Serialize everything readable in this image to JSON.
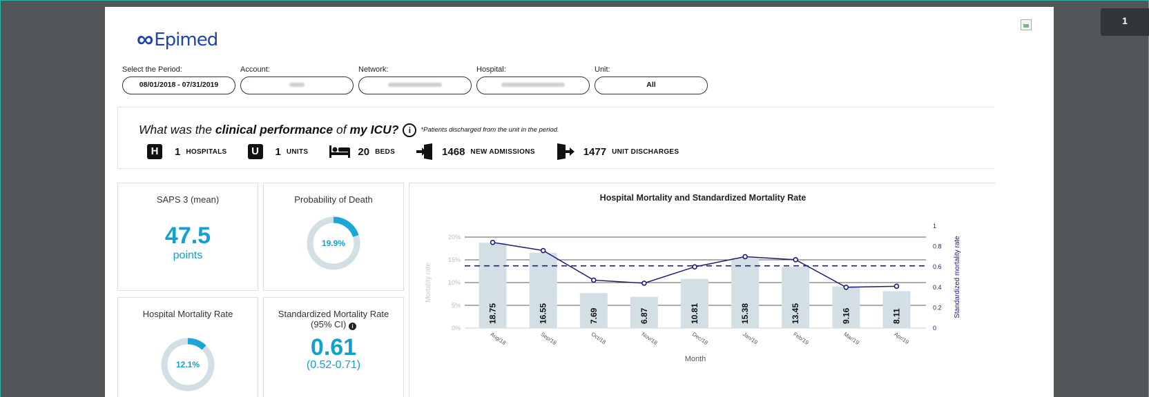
{
  "page_number": "1",
  "brand": {
    "logo_text": "Epimed"
  },
  "filters": {
    "period": {
      "label": "Select the Period:",
      "value": "08/01/2018 - 07/31/2019"
    },
    "account": {
      "label": "Account:"
    },
    "network": {
      "label": "Network:"
    },
    "hospital": {
      "label": "Hospital:"
    },
    "unit": {
      "label": "Unit:",
      "value": "All"
    }
  },
  "summary": {
    "question_start": "What was the ",
    "question_bold": "clinical performance",
    "question_mid": " of ",
    "question_end": "my ICU?",
    "footnote": "*Patients discharged from the unit in the period.",
    "stats": [
      {
        "icon": "H",
        "value": "1",
        "label": "HOSPITALS"
      },
      {
        "icon": "U",
        "value": "1",
        "label": "UNITS"
      },
      {
        "icon": "bed",
        "value": "20",
        "label": "BEDS"
      },
      {
        "icon": "enter",
        "value": "1468",
        "label": "NEW ADMISSIONS"
      },
      {
        "icon": "exit",
        "value": "1477",
        "label": "UNIT DISCHARGES"
      }
    ]
  },
  "cards": {
    "saps": {
      "title": "SAPS 3 (mean)",
      "value": "47.5",
      "unit": "points"
    },
    "prob_death": {
      "title": "Probability of Death",
      "value": "19.9%",
      "fraction": 0.199
    },
    "hosp_mortality": {
      "title": "Hospital Mortality Rate",
      "value": "12.1%",
      "fraction": 0.121
    },
    "smr": {
      "title": "Standardized Mortality Rate",
      "subtitle": "(95% CI)",
      "value": "0.61",
      "ci": "(0.52-0.71)"
    }
  },
  "colors": {
    "accent": "#14a0cf",
    "bar": "#d2dfe5",
    "line": "#1f1b6e",
    "ring_track": "#d2dfe5",
    "ring_fill": "#1aa6d6"
  },
  "chart_data": {
    "type": "bar",
    "title": "Hospital Mortality and Standardized Mortality Rate",
    "xlabel": "Month",
    "ylabel": "Mortality rate",
    "y2label": "Standardized mortality rate",
    "categories": [
      "Aug/18",
      "Sep/18",
      "Oct/18",
      "Nov/18",
      "Dec/18",
      "Jan/19",
      "Feb/19",
      "Mar/19",
      "Apr/19"
    ],
    "series": [
      {
        "name": "Mortality rate",
        "values": [
          18.75,
          16.55,
          7.69,
          6.87,
          10.81,
          15.38,
          13.45,
          9.16,
          8.11
        ],
        "labels": [
          "18.75",
          "16.55",
          "7.69",
          "6.87",
          "10.81",
          "15.38",
          "13.45",
          "9.16",
          "8.11"
        ]
      },
      {
        "name": "Standardized mortality rate",
        "axis": "right",
        "values": [
          0.84,
          0.76,
          0.47,
          0.44,
          0.6,
          0.7,
          0.67,
          0.4,
          0.41
        ]
      }
    ],
    "reference_line": 0.61,
    "ylim": [
      0,
      20
    ],
    "y2lim": [
      0,
      1
    ],
    "yticks": [
      "0%",
      "5%",
      "10%",
      "15%",
      "20%"
    ],
    "y2ticks": [
      "0",
      "0.2",
      "0.4",
      "0.6",
      "0.8",
      "1"
    ]
  }
}
